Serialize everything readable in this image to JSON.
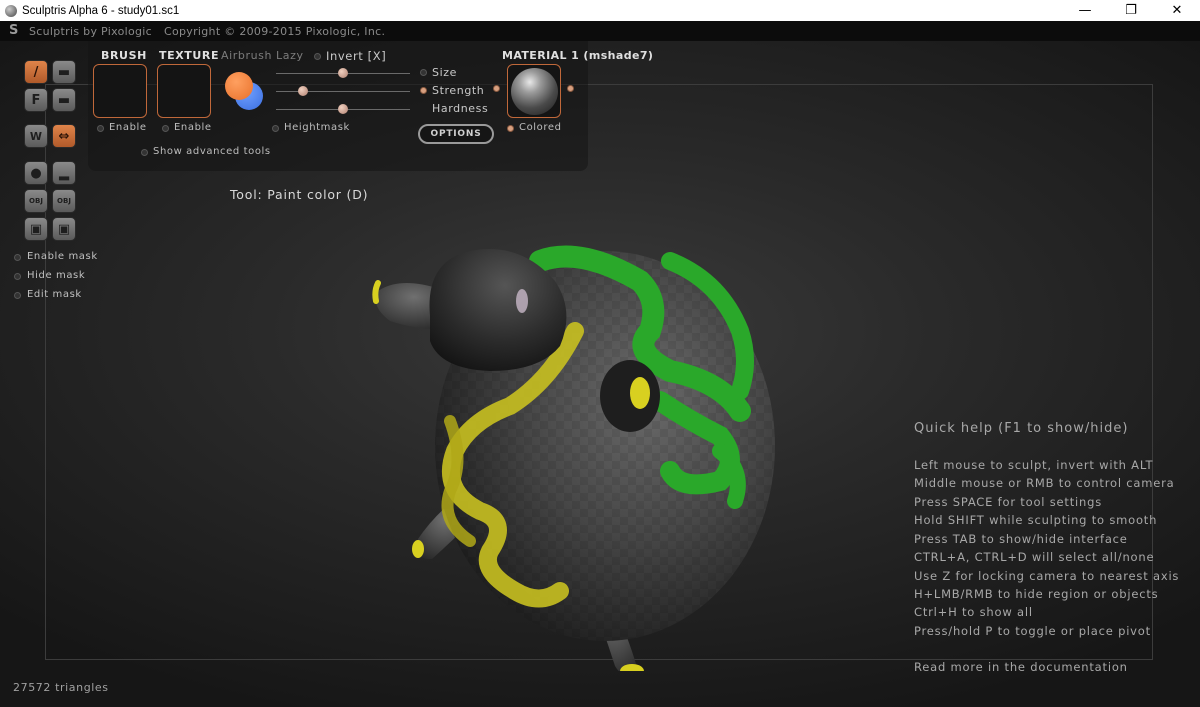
{
  "window": {
    "title": "Sculptris Alpha 6 - study01.sc1",
    "minimize_glyph": "—",
    "maximize_glyph": "❐",
    "close_glyph": "✕"
  },
  "header": {
    "app_name": "Sculptris by Pixologic",
    "copyright": "Copyright © 2009-2015 Pixologic, Inc."
  },
  "brush_panel": {
    "brush_label": "BRUSH",
    "texture_label": "TEXTURE",
    "airbrush_label": "Airbrush",
    "lazy_label": "Lazy",
    "invert_label": "Invert [X]",
    "brush_enable": "Enable",
    "texture_enable": "Enable",
    "heightmask": "Heightmask",
    "show_advanced": "Show advanced tools",
    "size_label": "Size",
    "strength_label": "Strength",
    "hardness_label": "Hardness",
    "options_button": "OPTIONS",
    "size_level": 0.5,
    "strength_level": 0.2,
    "hardness_level": 0.5,
    "primary_color": "#e8702a",
    "secondary_color": "#3a6ee0"
  },
  "material": {
    "label": "MATERIAL 1 (mshade7)",
    "colored_label": "Colored"
  },
  "left_toolbar": {
    "paint_icon": "paint-brush-icon",
    "flatten_glyph": "F",
    "symmetry_glyph": "⇔",
    "obj_label": "OBJ"
  },
  "mask": {
    "enable": "Enable mask",
    "hide": "Hide mask",
    "edit": "Edit mask"
  },
  "tool_status": "Tool: Paint color (D)",
  "quick_help": {
    "title": "Quick help (F1 to show/hide)",
    "lines": [
      "Left mouse to sculpt, invert with ALT",
      "Middle mouse or RMB to control camera",
      "Press SPACE for tool settings",
      "Hold SHIFT while sculpting to smooth",
      "Press TAB to show/hide interface",
      "CTRL+A, CTRL+D will select all/none",
      "Use Z for locking camera to nearest axis",
      "H+LMB/RMB to hide region or objects",
      "Ctrl+H to show all",
      "Press/hold P to toggle or place pivot"
    ],
    "doc_link": "Read more in the documentation"
  },
  "status": {
    "triangles": "27572 triangles"
  },
  "colors": {
    "accent": "#c0683a",
    "paint_green": "#2aa82a",
    "paint_yellow": "#c8c020"
  }
}
